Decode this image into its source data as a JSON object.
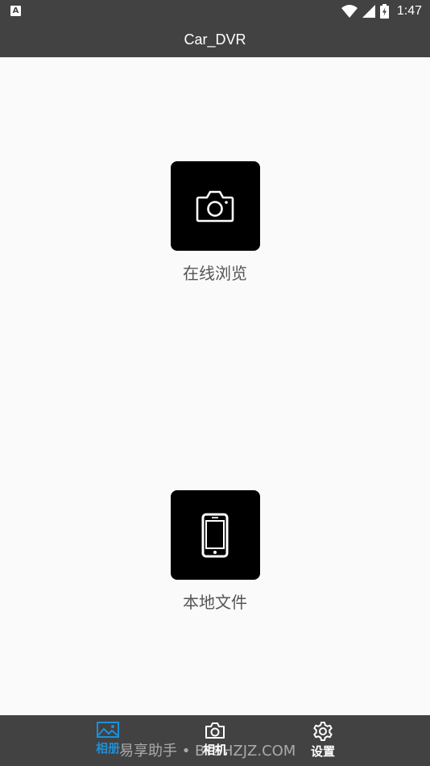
{
  "status_bar": {
    "notification_icon": "A",
    "icons": [
      "wifi-icon",
      "signal-icon",
      "battery-charging-icon"
    ],
    "time": "1:47"
  },
  "app_bar": {
    "title": "Car_DVR"
  },
  "main": {
    "online": {
      "icon": "camera-icon",
      "label": "在线浏览"
    },
    "local": {
      "icon": "phone-icon",
      "label": "本地文件"
    }
  },
  "bottom_nav": {
    "active": "album",
    "items": [
      {
        "id": "album",
        "icon": "image-icon",
        "label": "相册"
      },
      {
        "id": "camera",
        "icon": "camera-icon",
        "label": "相机"
      },
      {
        "id": "settings",
        "icon": "gear-icon",
        "label": "设置"
      }
    ]
  },
  "watermark": "易享助手 • BYSHZJZ.COM",
  "colors": {
    "bar": "#424242",
    "background": "#fafafa",
    "tile": "#000000",
    "accent": "#1e8fd8"
  }
}
